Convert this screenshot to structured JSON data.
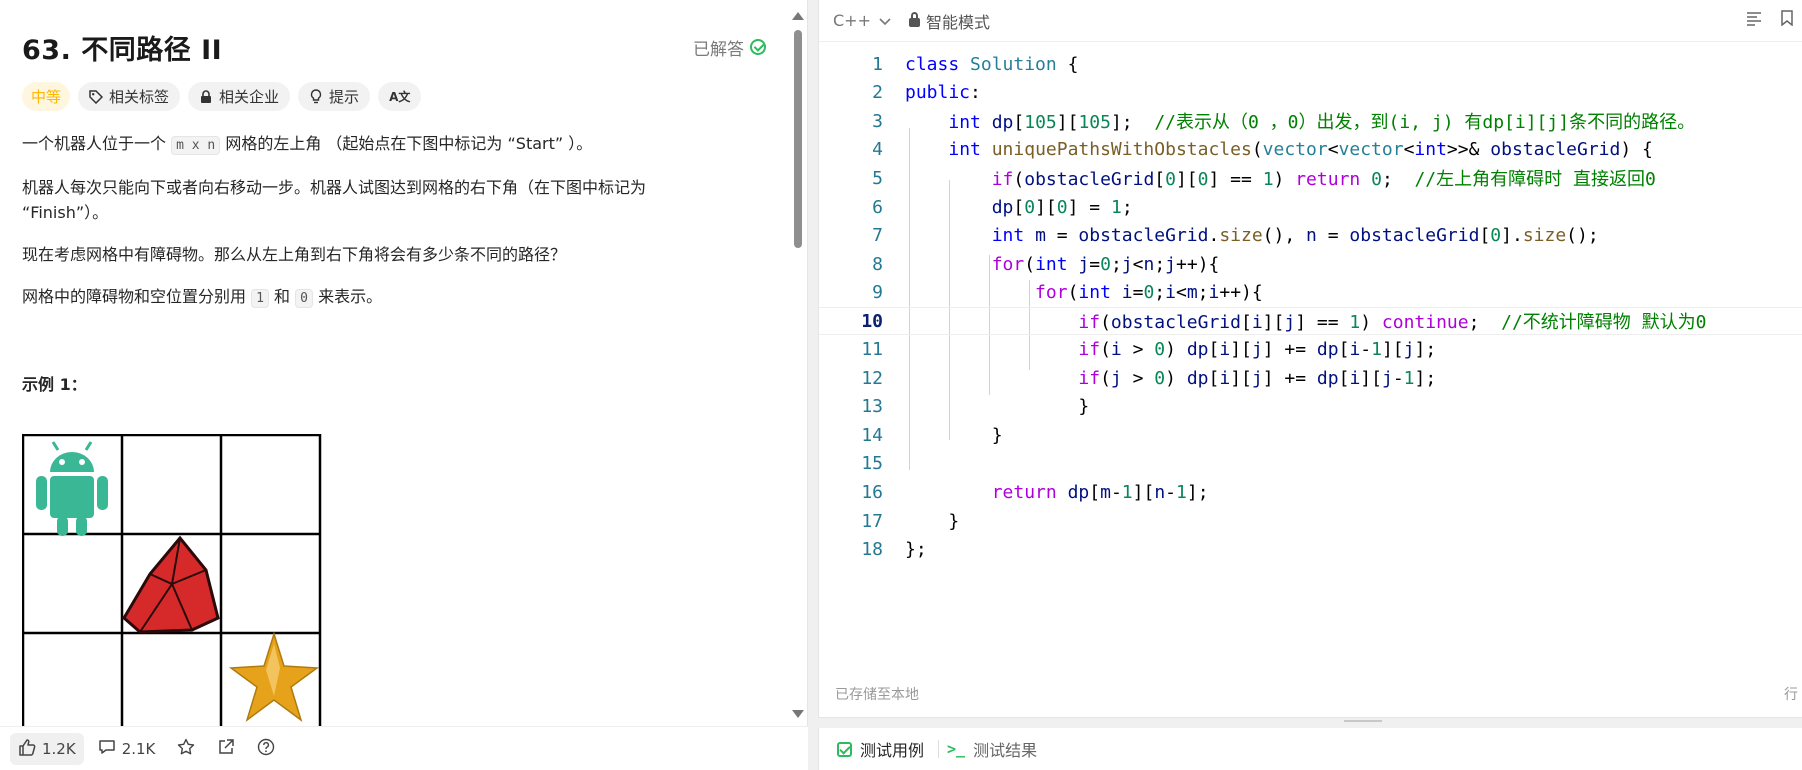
{
  "problem": {
    "title": "63. 不同路径 II",
    "status": "已解答",
    "difficulty": "中等",
    "tags": [
      "相关标签",
      "相关企业",
      "提示"
    ],
    "translate_icon": "A文",
    "desc1_a": "一个机器人位于一个",
    "desc1_code": "m x n",
    "desc1_b": "网格的左上角 （起始点在下图中标记为 “Start” ）。",
    "desc2": "机器人每次只能向下或者向右移动一步。机器人试图达到网格的右下角（在下图中标记为 “Finish”）。",
    "desc3": "现在考虑网格中有障碍物。那么从左上角到右下角将会有多少条不同的路径？",
    "desc4_a": "网格中的障碍物和空位置分别用",
    "desc4_code1": "1",
    "desc4_mid": "和",
    "desc4_code2": "0",
    "desc4_b": "来表示。",
    "example_title": "示例 1："
  },
  "footer": {
    "likes": "1.2K",
    "comments": "2.1K"
  },
  "editor": {
    "language": "C++",
    "mode": "智能模式",
    "saved_status": "已存储至本地",
    "row_indicator": "行",
    "lines": [
      "1",
      "2",
      "3",
      "4",
      "5",
      "6",
      "7",
      "8",
      "9",
      "10",
      "11",
      "12",
      "13",
      "14",
      "15",
      "16",
      "17",
      "18"
    ]
  },
  "bottom_tabs": {
    "test_cases": "测试用例",
    "test_results": "测试结果"
  },
  "colors": {
    "accent_green": "#2cbb5d",
    "difficulty_orange": "#ffb800"
  }
}
